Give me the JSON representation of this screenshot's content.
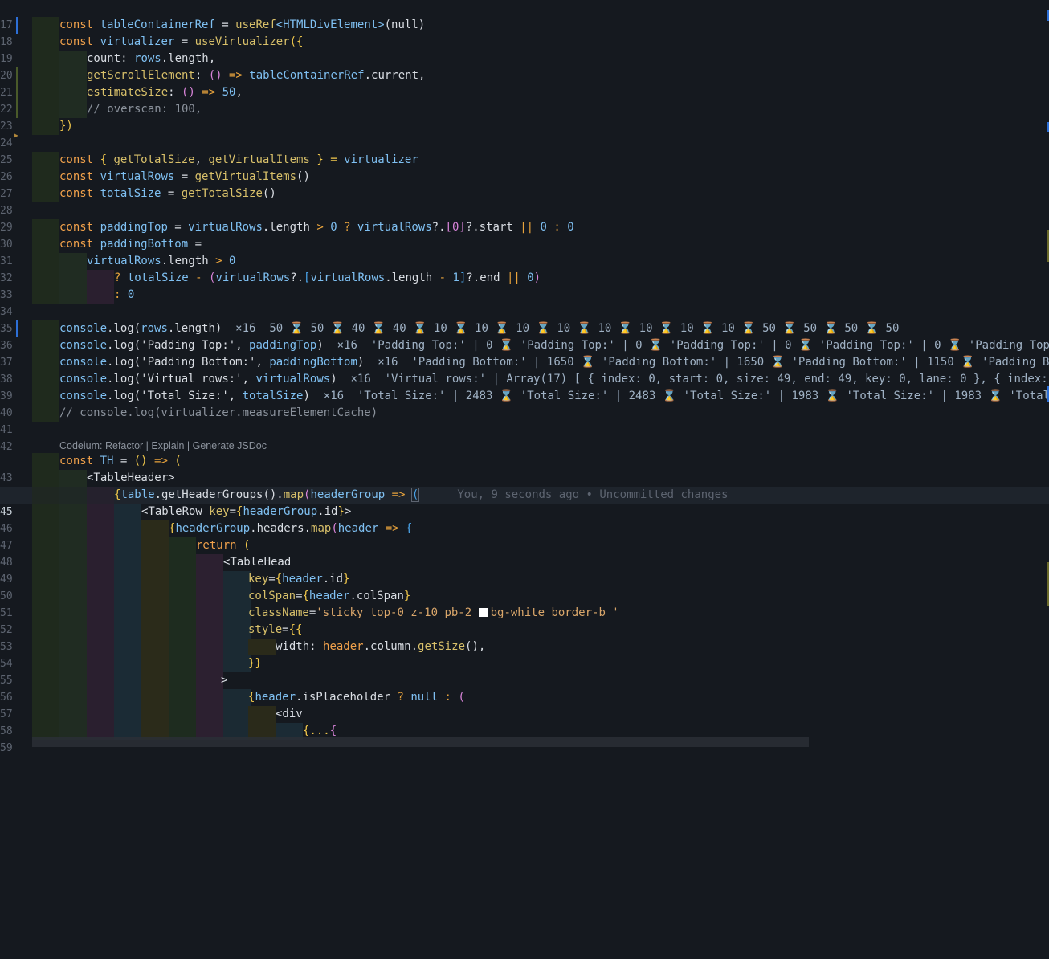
{
  "editor": {
    "codelens": "Codeium: Refactor | Explain | Generate JSDoc",
    "blame": "You, 9 seconds ago • Uncommitted changes",
    "line_numbers": [
      "17",
      "18",
      "19",
      "20",
      "21",
      "22",
      "23",
      "24",
      "25",
      "26",
      "27",
      "28",
      "29",
      "30",
      "31",
      "32",
      "33",
      "34",
      "35",
      "36",
      "37",
      "38",
      "39",
      "40",
      "41",
      "42",
      "43",
      "44",
      "45",
      "46",
      "47",
      "48",
      "49",
      "50",
      "51",
      "52",
      "53",
      "54",
      "55",
      "56",
      "57",
      "58",
      "59"
    ],
    "lines": {
      "l18": [
        "const",
        " tableContainerRef",
        " = ",
        "useRef",
        "<HTMLDivElement>",
        "(null)"
      ],
      "l19": [
        "const",
        " virtualizer",
        " = ",
        "useVirtualizer",
        "({"
      ],
      "l20": [
        "count",
        ": ",
        "rows",
        ".length,"
      ],
      "l21": [
        "getScrollElement",
        ": ",
        "()",
        " => ",
        "tableContainerRef",
        ".current,"
      ],
      "l22": [
        "estimateSize",
        ": ",
        "()",
        " => ",
        "50",
        ","
      ],
      "l23": [
        "// overscan: 100,"
      ],
      "l24": [
        "})"
      ],
      "l26": [
        "const",
        " { ",
        "getTotalSize",
        ", ",
        "getVirtualItems",
        " } = ",
        "virtualizer"
      ],
      "l27": [
        "const",
        " virtualRows",
        " = ",
        "getVirtualItems",
        "()"
      ],
      "l28": [
        "const",
        " totalSize",
        " = ",
        "getTotalSize",
        "()"
      ],
      "l30": [
        "const",
        " paddingTop",
        " = ",
        "virtualRows",
        ".length ",
        ">",
        " 0 ",
        "?",
        " virtualRows",
        "?.",
        "[0]",
        "?.start ",
        "||",
        " 0 ",
        ":",
        " 0"
      ],
      "l31": [
        "const",
        " paddingBottom",
        " ="
      ],
      "l32": [
        "virtualRows",
        ".length ",
        ">",
        " 0"
      ],
      "l33": [
        "?",
        " totalSize",
        " - ",
        "(",
        "virtualRows",
        "?.",
        "[",
        "virtualRows",
        ".length ",
        "-",
        " 1",
        "]",
        "?.end ",
        "||",
        " 0",
        ")"
      ],
      "l34": [
        ":",
        " 0"
      ],
      "l36": [
        "console",
        ".log(",
        "rows",
        ".length)",
        "  ×16  50 ⌛ 50 ⌛ 40 ⌛ 40 ⌛ 10 ⌛ 10 ⌛ 10 ⌛ 10 ⌛ 10 ⌛ 10 ⌛ 10 ⌛ 10 ⌛ 50 ⌛ 50 ⌛ 50 ⌛ 50"
      ],
      "l37": [
        "console",
        ".log(",
        "'Padding Top:'",
        ", ",
        "paddingTop",
        ")",
        "  ×16  'Padding Top:' | 0 ⌛ 'Padding Top:' | 0 ⌛ 'Padding Top:' | 0 ⌛ 'Padding Top:' | 0 ⌛ 'Padding Top"
      ],
      "l38": [
        "console",
        ".log(",
        "'Padding Bottom:'",
        ", ",
        "paddingBottom",
        ")",
        "  ×16  'Padding Bottom:' | 1650 ⌛ 'Padding Bottom:' | 1650 ⌛ 'Padding Bottom:' | 1150 ⌛ 'Padding Bo"
      ],
      "l39": [
        "console",
        ".log(",
        "'Virtual rows:'",
        ", ",
        "virtualRows",
        ")",
        "  ×16  'Virtual rows:' | Array(17) [ { index: 0, start: 0, size: 49, end: 49, key: 0, lane: 0 }, { index:"
      ],
      "l40": [
        "console",
        ".log(",
        "'Total Size:'",
        ", ",
        "totalSize",
        ")",
        "  ×16  'Total Size:' | 2483 ⌛ 'Total Size:' | 2483 ⌛ 'Total Size:' | 1983 ⌛ 'Total Size:' | 1983 ⌛ 'Total"
      ],
      "l41": [
        "// console.log(virtualizer.measureElementCache)"
      ],
      "l43": [
        "const",
        " TH",
        " = ",
        "()",
        " => ",
        "("
      ],
      "l44": [
        "<TableHeader>"
      ],
      "l45": [
        "{",
        "table",
        ".getHeaderGroups().",
        "map",
        "(",
        "headerGroup",
        " => ",
        "("
      ],
      "l46": [
        "<TableRow",
        " key",
        "=",
        "{",
        "headerGroup",
        ".id",
        "}",
        ">"
      ],
      "l47": [
        "{",
        "headerGroup",
        ".headers.",
        "map",
        "(",
        "header",
        " => ",
        "{"
      ],
      "l48": [
        "return",
        " ("
      ],
      "l49": [
        "<TableHead"
      ],
      "l50": [
        "key",
        "=",
        "{",
        "header",
        ".id",
        "}"
      ],
      "l51": [
        "colSpan",
        "=",
        "{",
        "header",
        ".colSpan",
        "}"
      ],
      "l52": [
        "className",
        "=",
        "'sticky top-0 z-10 pb-2 ",
        "bg-white border-b '"
      ],
      "l53": [
        "style",
        "=",
        "{{"
      ],
      "l54": [
        "width",
        ": ",
        "header",
        ".column.",
        "getSize",
        "(),"
      ],
      "l55": [
        "}}"
      ],
      "l56": [
        ">"
      ],
      "l57": [
        "{",
        "header",
        ".isPlaceholder ",
        "?",
        " null ",
        ":",
        " ("
      ],
      "l58": [
        "<div"
      ],
      "l59": [
        "{...",
        "{"
      ]
    }
  },
  "colors": {
    "background": "#15191f",
    "keyword": "#f0a14b",
    "function": "#d8c06a",
    "variable": "#7fc0f2",
    "string": "#d9a66a",
    "comment": "#8b929c"
  }
}
